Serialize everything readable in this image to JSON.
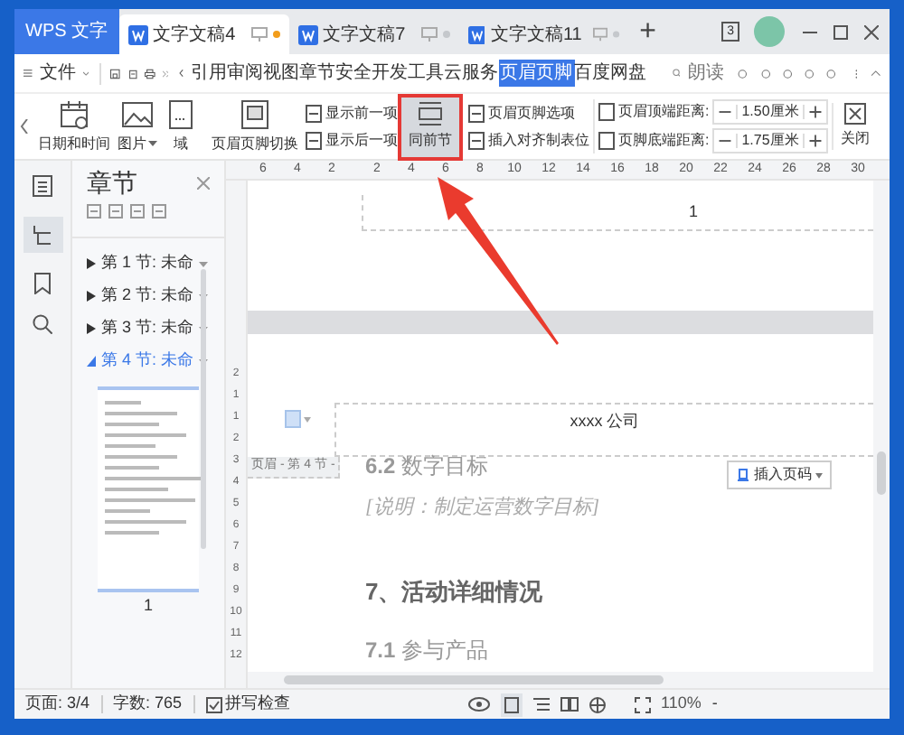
{
  "tabs": [
    {
      "label": "WPS 文字",
      "kind": "app",
      "selected": false
    },
    {
      "label": "文字文稿4",
      "kind": "doc",
      "selected": true,
      "unsaved": true
    },
    {
      "label": "文字文稿7",
      "kind": "doc",
      "selected": false,
      "unsaved": false
    },
    {
      "label": "文字文稿11",
      "kind": "doc",
      "selected": false,
      "unsaved": false
    }
  ],
  "new_tab": "+",
  "window_badge": "3",
  "menu": {
    "file": "文件",
    "items": [
      {
        "label": "引用",
        "selected": false
      },
      {
        "label": "审阅",
        "selected": false
      },
      {
        "label": "视图",
        "selected": false
      },
      {
        "label": "章节",
        "selected": false
      },
      {
        "label": "安全",
        "selected": false
      },
      {
        "label": "开发工具",
        "selected": false
      },
      {
        "label": "云服务",
        "selected": false
      },
      {
        "label": "页眉页脚",
        "selected": true
      },
      {
        "label": "百度网盘",
        "selected": false
      }
    ],
    "search": "朗读"
  },
  "ribbon": {
    "large": [
      {
        "label": "日期和时间",
        "dropdown": false
      },
      {
        "label": "图片",
        "dropdown": true
      },
      {
        "label": "域",
        "dropdown": false
      },
      {
        "label": "页眉页脚切换",
        "dropdown": false
      }
    ],
    "pair1": [
      "显示前一项",
      "显示后一项"
    ],
    "same_as_previous": {
      "label": "同前节",
      "selected": true
    },
    "pair2": [
      "页眉页脚选项",
      "插入对齐制表位"
    ],
    "spinners": [
      {
        "label": "页眉顶端距离:",
        "value": "1.50厘米"
      },
      {
        "label": "页脚底端距离:",
        "value": "1.75厘米"
      }
    ],
    "close": "关闭"
  },
  "sidebar": {
    "title": "章节",
    "sections": [
      {
        "label": "第 1 节: 未命",
        "selected": false
      },
      {
        "label": "第 2 节: 未命",
        "selected": false
      },
      {
        "label": "第 3 节: 未命",
        "selected": false
      },
      {
        "label": "第 4 节: 未命",
        "selected": true
      }
    ],
    "thumbnail_label": "1"
  },
  "ruler": [
    "6",
    "4",
    "2",
    "2",
    "4",
    "6",
    "8",
    "10",
    "12",
    "14",
    "16",
    "18",
    "20",
    "22",
    "24",
    "26",
    "28",
    "30"
  ],
  "vertical_ruler": [
    "2",
    "1",
    "1",
    "2",
    "3",
    "4",
    "5",
    "6",
    "7",
    "8",
    "9",
    "10",
    "11",
    "12"
  ],
  "document": {
    "footer_number": "1",
    "header_text": "xxxx 公司",
    "header_label": "页眉 - 第 4 节 -",
    "insert_page_number": "插入页码",
    "blocks": [
      {
        "kind": "subheading",
        "text": "**6.2** 数字目标"
      },
      {
        "kind": "note",
        "text": "[说明：制定运营数字目标]"
      },
      {
        "kind": "heading",
        "text": "7、活动详细情况"
      },
      {
        "kind": "subheading",
        "text": "**7.1** 参与产品"
      }
    ]
  },
  "status_bar": {
    "page": "页面: 3/4",
    "words": "字数: 765",
    "spell_check": "拼写检查",
    "zoom": "110%",
    "zoom_out": "-"
  }
}
